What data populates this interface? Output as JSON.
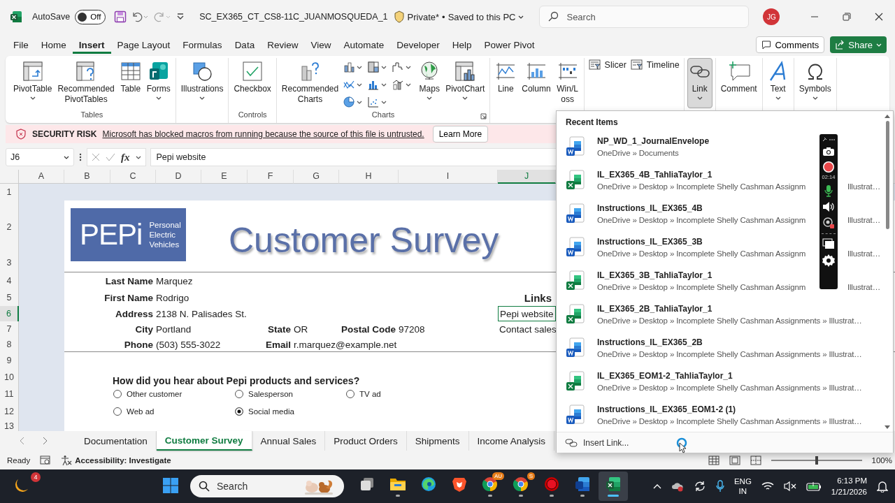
{
  "title_bar": {
    "autosave_label": "AutoSave",
    "autosave": {
      "on": false,
      "label": "Off"
    },
    "file_name": "SC_EX365_CT_CS8-11C_JUANMOSQUEDA_1",
    "sensitivity": "Private*",
    "separator": "•",
    "save_status": "Saved to this PC",
    "search": {
      "placeholder": "Search"
    },
    "avatar": "JG"
  },
  "menu_tabs": [
    {
      "label": "File",
      "selected": false
    },
    {
      "label": "Home",
      "selected": false
    },
    {
      "label": "Insert",
      "selected": true
    },
    {
      "label": "Page Layout",
      "selected": false
    },
    {
      "label": "Formulas",
      "selected": false
    },
    {
      "label": "Data",
      "selected": false
    },
    {
      "label": "Review",
      "selected": false
    },
    {
      "label": "View",
      "selected": false
    },
    {
      "label": "Automate",
      "selected": false
    },
    {
      "label": "Developer",
      "selected": false
    },
    {
      "label": "Help",
      "selected": false
    },
    {
      "label": "Power Pivot",
      "selected": false
    }
  ],
  "comments_button": "Comments",
  "share_button": "Share",
  "ribbon": [
    {
      "label": "Tables",
      "items": [
        {
          "kind": "pivottable",
          "label": "PivotTable",
          "dropdown": true,
          "pressed": false
        },
        {
          "kind": "recommended-pivot",
          "label": "Recommended PivotTables",
          "dropdown": false,
          "pressed": false
        },
        {
          "kind": "table",
          "label": "Table",
          "dropdown": false,
          "pressed": false
        },
        {
          "kind": "forms",
          "label": "Forms",
          "dropdown": true,
          "pressed": false
        }
      ]
    },
    {
      "items": [
        {
          "kind": "illustrations",
          "label": "Illustrations",
          "dropdown": true,
          "pressed": false
        }
      ]
    },
    {
      "label": "Controls",
      "items": [
        {
          "kind": "checkbox",
          "label": "Checkbox",
          "dropdown": false,
          "pressed": false
        }
      ]
    },
    {
      "label": "Charts",
      "launcher": true,
      "items": [
        {
          "kind": "recommended-charts",
          "label": "Recommended Charts",
          "dropdown": false,
          "pressed": false
        },
        {
          "kind": "chart-gallery"
        },
        {
          "kind": "maps",
          "label": "Maps",
          "dropdown": true,
          "pressed": false
        },
        {
          "kind": "pivotchart",
          "label": "PivotChart",
          "dropdown": true,
          "pressed": false
        }
      ]
    },
    {
      "items": [
        {
          "kind": "line",
          "label": "Line",
          "dropdown": false,
          "pressed": false
        },
        {
          "kind": "column",
          "label": "Column",
          "dropdown": false,
          "pressed": false
        },
        {
          "kind": "winloss",
          "label": "Win/Loss",
          "dropdown": false,
          "pressed": false
        }
      ]
    },
    {
      "items": [
        {
          "kind": "slicer",
          "label": "Slicer"
        },
        {
          "kind": "timeline",
          "label": "Timeline"
        }
      ]
    },
    {
      "items": [
        {
          "kind": "link",
          "label": "Link",
          "dropdown": true,
          "pressed": true
        }
      ]
    },
    {
      "items": [
        {
          "kind": "comment",
          "label": "Comment",
          "dropdown": false,
          "pressed": false
        }
      ]
    },
    {
      "items": [
        {
          "kind": "text",
          "label": "Text",
          "dropdown": true,
          "pressed": false
        }
      ]
    },
    {
      "items": [
        {
          "kind": "symbols",
          "label": "Symbols",
          "dropdown": true,
          "pressed": false
        }
      ]
    }
  ],
  "security_bar": {
    "title": "SECURITY RISK",
    "message": "Microsoft has blocked macros from running because the source of this file is untrusted.",
    "button": "Learn More"
  },
  "formula_bar": {
    "name_box": "J6",
    "function_label": "fx",
    "value": "Pepi website"
  },
  "sheet": {
    "columns": [
      {
        "label": "A",
        "selected": false
      },
      {
        "label": "B",
        "selected": false
      },
      {
        "label": "C",
        "selected": false
      },
      {
        "label": "D",
        "selected": false
      },
      {
        "label": "E",
        "selected": false
      },
      {
        "label": "F",
        "selected": false
      },
      {
        "label": "G",
        "selected": false
      },
      {
        "label": "H",
        "selected": false
      },
      {
        "label": "I",
        "selected": false
      },
      {
        "label": "J",
        "selected": true
      }
    ],
    "rows": [
      {
        "label": "1",
        "selected": false
      },
      {
        "label": "2",
        "selected": false
      },
      {
        "label": "3",
        "selected": false
      },
      {
        "label": "4",
        "selected": false
      },
      {
        "label": "5",
        "selected": false
      },
      {
        "label": "6",
        "selected": true
      },
      {
        "label": "7",
        "selected": false
      },
      {
        "label": "8",
        "selected": false
      },
      {
        "label": "9",
        "selected": false
      },
      {
        "label": "10",
        "selected": false
      },
      {
        "label": "11",
        "selected": false
      },
      {
        "label": "12",
        "selected": false
      },
      {
        "label": "13",
        "selected": false
      }
    ],
    "logo": {
      "mark": "PEPi",
      "tagline": "Personal Electric Vehicles"
    },
    "title": "Customer Survey",
    "contact_rows": [
      [
        {
          "label": "Last Name",
          "value": "Marquez"
        }
      ],
      [
        {
          "label": "First Name",
          "value": "Rodrigo"
        }
      ],
      [
        {
          "label": "Address",
          "value": "2138 N. Palisades St."
        }
      ],
      [
        {
          "label": "City",
          "value": "Portland"
        },
        {
          "label": "State",
          "value": "OR"
        },
        {
          "label": "Postal Code",
          "value": "97208"
        }
      ],
      [
        {
          "label": "Phone",
          "value": "(503) 555-3022"
        },
        {
          "label": "Email",
          "value": "r.marquez@example.net"
        }
      ]
    ],
    "links_heading": "Links",
    "links": [
      {
        "label": "Pepi website",
        "selected": true
      },
      {
        "label": "Contact sales",
        "selected": false
      }
    ],
    "question": "How did you hear about Pepi products and services?",
    "options": [
      {
        "label": "Other customer",
        "selected": false
      },
      {
        "label": "Salesperson",
        "selected": false
      },
      {
        "label": "TV ad",
        "selected": false
      },
      {
        "label": "Web ad",
        "selected": false
      },
      {
        "label": "Social media",
        "selected": true
      }
    ]
  },
  "sheet_tabs": [
    {
      "label": "Documentation",
      "selected": false
    },
    {
      "label": "Customer Survey",
      "selected": true
    },
    {
      "label": "Annual Sales",
      "selected": false
    },
    {
      "label": "Product Orders",
      "selected": false
    },
    {
      "label": "Shipments",
      "selected": false
    },
    {
      "label": "Income Analysis",
      "selected": false
    }
  ],
  "status_bar": {
    "status": "Ready",
    "accessibility": "Accessibility: Investigate",
    "zoom_slider": {
      "level": 0.5
    },
    "zoom": "100%"
  },
  "link_menu": {
    "heading": "Recent Items",
    "footer": "Insert Link...",
    "items": [
      {
        "kind": "word",
        "name": "NP_WD_1_JournalEnvelope",
        "path": "OneDrive » Documents"
      },
      {
        "kind": "excel",
        "name": "IL_EX365_4B_TahliaTaylor_1",
        "path": "OneDrive » Desktop » Incomplete Shelly Cashman Assignm",
        "path_end": "Illustrat…"
      },
      {
        "kind": "word",
        "name": "Instructions_IL_EX365_4B",
        "path": "OneDrive » Desktop » Incomplete Shelly Cashman Assignm",
        "path_end": "Illustrat…"
      },
      {
        "kind": "word",
        "name": "Instructions_IL_EX365_3B",
        "path": "OneDrive » Desktop » Incomplete Shelly Cashman Assignm",
        "path_end": "Illustrat…"
      },
      {
        "kind": "excel",
        "name": "IL_EX365_3B_TahliaTaylor_1",
        "path": "OneDrive » Desktop » Incomplete Shelly Cashman Assignm",
        "path_end": "Illustrat…"
      },
      {
        "kind": "excel",
        "name": "IL_EX365_2B_TahliaTaylor_1",
        "path": "OneDrive » Desktop » Incomplete Shelly Cashman Assignments » Illustrat…"
      },
      {
        "kind": "word",
        "name": "Instructions_IL_EX365_2B",
        "path": "OneDrive » Desktop » Incomplete Shelly Cashman Assignments » Illustrat…"
      },
      {
        "kind": "excel",
        "name": "IL_EX365_EOM1-2_TahliaTaylor_1",
        "path": "OneDrive » Desktop » Incomplete Shelly Cashman Assignments » Illustrat…"
      },
      {
        "kind": "word",
        "name": "Instructions_IL_EX365_EOM1-2 (1)",
        "path": "OneDrive » Desktop » Incomplete Shelly Cashman Assignments » Illustrat…"
      }
    ]
  },
  "recorder": {
    "time": "02:14"
  },
  "taskbar": {
    "weather_badge": "4",
    "search": {
      "placeholder": "Search"
    },
    "apps": [
      {
        "kind": "task-view",
        "running": false,
        "selected": false
      },
      {
        "kind": "folder",
        "running": true,
        "selected": false
      },
      {
        "kind": "edge",
        "running": false,
        "selected": false
      },
      {
        "kind": "brave",
        "running": false,
        "selected": false
      },
      {
        "kind": "chrome",
        "badge": "AU",
        "running": true,
        "selected": false
      },
      {
        "kind": "chrome",
        "badge": "S",
        "running": true,
        "selected": false
      },
      {
        "kind": "record",
        "running": true,
        "selected": false
      },
      {
        "kind": "word",
        "running": true,
        "selected": false
      },
      {
        "kind": "excel",
        "running": true,
        "selected": true
      }
    ],
    "language": "ENG",
    "region": "IN",
    "time": "6:13 PM",
    "date": "1/21/2026"
  }
}
